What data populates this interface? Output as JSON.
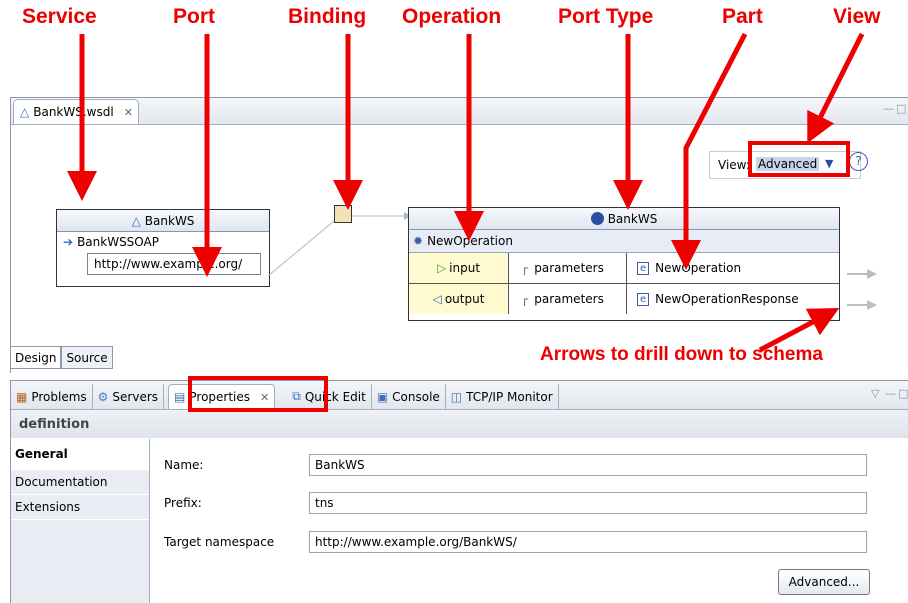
{
  "callouts": {
    "service": "Service",
    "port": "Port",
    "binding": "Binding",
    "operation": "Operation",
    "port_type": "Port Type",
    "part": "Part",
    "view": "View",
    "arrows": "Arrows to drill down to schema"
  },
  "editor": {
    "tab_title": "BankWS.wsdl",
    "view_label": "View:",
    "view_value": "Advanced",
    "help": "?",
    "service_box": {
      "title": "BankWS",
      "port_name": "BankWSSOAP",
      "address": "http://www.example.org/"
    },
    "porttype_box": {
      "title": "BankWS",
      "operation": "NewOperation",
      "rows": [
        {
          "io": "input",
          "param": "parameters",
          "element": "NewOperation"
        },
        {
          "io": "output",
          "param": "parameters",
          "element": "NewOperationResponse"
        }
      ]
    },
    "bottom_tabs": [
      "Design",
      "Source"
    ]
  },
  "views": {
    "tabs": [
      "Problems",
      "Servers",
      "Properties",
      "Quick Edit",
      "Console",
      "TCP/IP Monitor"
    ],
    "section_title": "definition",
    "side_tabs": [
      "General",
      "Documentation",
      "Extensions"
    ],
    "fields": {
      "name_label": "Name:",
      "name_value": "BankWS",
      "prefix_label": "Prefix:",
      "prefix_value": "tns",
      "ns_label": "Target namespace",
      "ns_value": "http://www.example.org/BankWS/"
    },
    "advanced_button": "Advanced..."
  },
  "colors": {
    "callout": "#ee0000",
    "accent": "#3c5c9c"
  }
}
